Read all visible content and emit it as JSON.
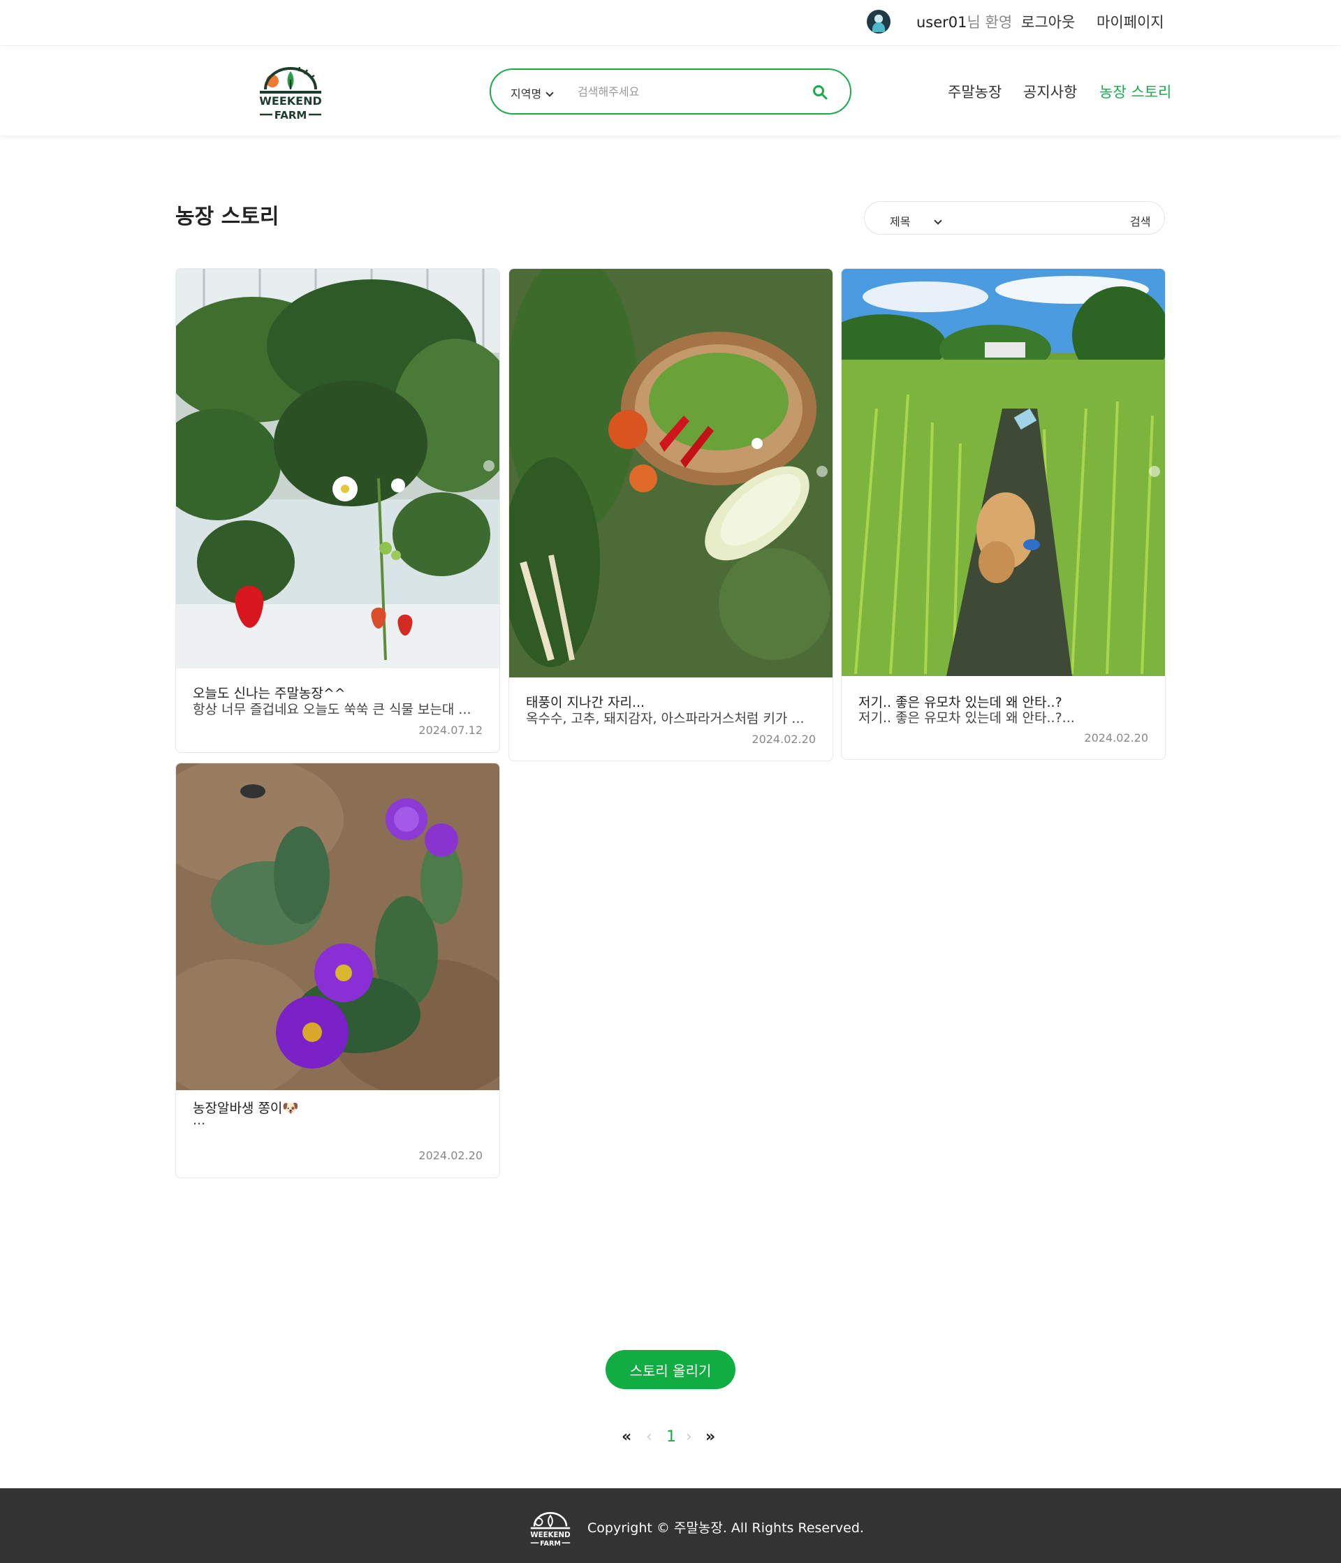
{
  "topbar": {
    "username": "user01",
    "welcome_suffix": "님 환영",
    "logout": "로그아웃",
    "mypage": "마이페이지"
  },
  "header": {
    "logo_text_top": "WEEKEND",
    "logo_text_bottom": "FARM",
    "search_region": "지역명",
    "search_placeholder": "검색해주세요",
    "nav": [
      "주말농장",
      "공지사항",
      "농장 스토리"
    ],
    "active_nav": "농장 스토리"
  },
  "page": {
    "title": "농장 스토리",
    "filter_type": "제목",
    "filter_button": "검색"
  },
  "posts": [
    {
      "title": "오늘도 신나는 주말농장^^",
      "excerpt": "항상 너무 즐겁네요 오늘도 쑥쑥 큰 식물 보는대 ...",
      "date": "2024.07.12",
      "photo": "strawberry-plant-photo"
    },
    {
      "title": "태풍이 지나간 자리...",
      "excerpt": "옥수수, 고추, 돼지감자, 아스파라거스처럼 키가 ...",
      "date": "2024.02.20",
      "photo": "vegetable-harvest-photo"
    },
    {
      "title": "저기.. 좋은 유모차 있는데 왜 안타..?",
      "excerpt": "저기.. 좋은 유모차 있는데 왜 안타..?...",
      "date": "2024.02.20",
      "photo": "garlic-field-dog-photo"
    },
    {
      "title": "농장알바생 쫑이🐶",
      "excerpt": "...",
      "date": "2024.02.20",
      "photo": "purple-flowers-photo"
    }
  ],
  "actions": {
    "upload_story": "스토리 올리기"
  },
  "pagination": {
    "first": "«",
    "prev": "‹",
    "current": "1",
    "next": "›",
    "last": "»"
  },
  "footer": {
    "copyright": "Copyright © 주말농장. All Rights Reserved."
  },
  "colors": {
    "accent": "#1aaa4b",
    "button": "#12ad42",
    "footer_bg": "#333333"
  }
}
